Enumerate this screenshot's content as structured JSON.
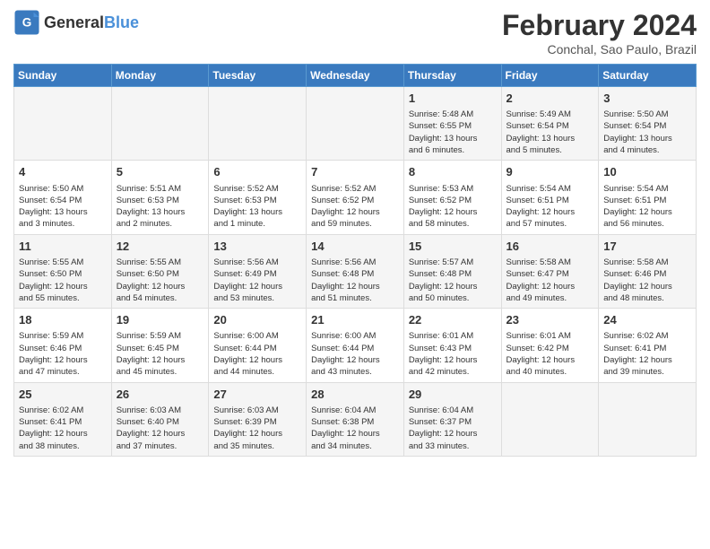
{
  "header": {
    "logo_general": "General",
    "logo_blue": "Blue",
    "title": "February 2024",
    "subtitle": "Conchal, Sao Paulo, Brazil"
  },
  "days_of_week": [
    "Sunday",
    "Monday",
    "Tuesday",
    "Wednesday",
    "Thursday",
    "Friday",
    "Saturday"
  ],
  "weeks": [
    [
      {
        "day": "",
        "content": ""
      },
      {
        "day": "",
        "content": ""
      },
      {
        "day": "",
        "content": ""
      },
      {
        "day": "",
        "content": ""
      },
      {
        "day": "1",
        "content": "Sunrise: 5:48 AM\nSunset: 6:55 PM\nDaylight: 13 hours\nand 6 minutes."
      },
      {
        "day": "2",
        "content": "Sunrise: 5:49 AM\nSunset: 6:54 PM\nDaylight: 13 hours\nand 5 minutes."
      },
      {
        "day": "3",
        "content": "Sunrise: 5:50 AM\nSunset: 6:54 PM\nDaylight: 13 hours\nand 4 minutes."
      }
    ],
    [
      {
        "day": "4",
        "content": "Sunrise: 5:50 AM\nSunset: 6:54 PM\nDaylight: 13 hours\nand 3 minutes."
      },
      {
        "day": "5",
        "content": "Sunrise: 5:51 AM\nSunset: 6:53 PM\nDaylight: 13 hours\nand 2 minutes."
      },
      {
        "day": "6",
        "content": "Sunrise: 5:52 AM\nSunset: 6:53 PM\nDaylight: 13 hours\nand 1 minute."
      },
      {
        "day": "7",
        "content": "Sunrise: 5:52 AM\nSunset: 6:52 PM\nDaylight: 12 hours\nand 59 minutes."
      },
      {
        "day": "8",
        "content": "Sunrise: 5:53 AM\nSunset: 6:52 PM\nDaylight: 12 hours\nand 58 minutes."
      },
      {
        "day": "9",
        "content": "Sunrise: 5:54 AM\nSunset: 6:51 PM\nDaylight: 12 hours\nand 57 minutes."
      },
      {
        "day": "10",
        "content": "Sunrise: 5:54 AM\nSunset: 6:51 PM\nDaylight: 12 hours\nand 56 minutes."
      }
    ],
    [
      {
        "day": "11",
        "content": "Sunrise: 5:55 AM\nSunset: 6:50 PM\nDaylight: 12 hours\nand 55 minutes."
      },
      {
        "day": "12",
        "content": "Sunrise: 5:55 AM\nSunset: 6:50 PM\nDaylight: 12 hours\nand 54 minutes."
      },
      {
        "day": "13",
        "content": "Sunrise: 5:56 AM\nSunset: 6:49 PM\nDaylight: 12 hours\nand 53 minutes."
      },
      {
        "day": "14",
        "content": "Sunrise: 5:56 AM\nSunset: 6:48 PM\nDaylight: 12 hours\nand 51 minutes."
      },
      {
        "day": "15",
        "content": "Sunrise: 5:57 AM\nSunset: 6:48 PM\nDaylight: 12 hours\nand 50 minutes."
      },
      {
        "day": "16",
        "content": "Sunrise: 5:58 AM\nSunset: 6:47 PM\nDaylight: 12 hours\nand 49 minutes."
      },
      {
        "day": "17",
        "content": "Sunrise: 5:58 AM\nSunset: 6:46 PM\nDaylight: 12 hours\nand 48 minutes."
      }
    ],
    [
      {
        "day": "18",
        "content": "Sunrise: 5:59 AM\nSunset: 6:46 PM\nDaylight: 12 hours\nand 47 minutes."
      },
      {
        "day": "19",
        "content": "Sunrise: 5:59 AM\nSunset: 6:45 PM\nDaylight: 12 hours\nand 45 minutes."
      },
      {
        "day": "20",
        "content": "Sunrise: 6:00 AM\nSunset: 6:44 PM\nDaylight: 12 hours\nand 44 minutes."
      },
      {
        "day": "21",
        "content": "Sunrise: 6:00 AM\nSunset: 6:44 PM\nDaylight: 12 hours\nand 43 minutes."
      },
      {
        "day": "22",
        "content": "Sunrise: 6:01 AM\nSunset: 6:43 PM\nDaylight: 12 hours\nand 42 minutes."
      },
      {
        "day": "23",
        "content": "Sunrise: 6:01 AM\nSunset: 6:42 PM\nDaylight: 12 hours\nand 40 minutes."
      },
      {
        "day": "24",
        "content": "Sunrise: 6:02 AM\nSunset: 6:41 PM\nDaylight: 12 hours\nand 39 minutes."
      }
    ],
    [
      {
        "day": "25",
        "content": "Sunrise: 6:02 AM\nSunset: 6:41 PM\nDaylight: 12 hours\nand 38 minutes."
      },
      {
        "day": "26",
        "content": "Sunrise: 6:03 AM\nSunset: 6:40 PM\nDaylight: 12 hours\nand 37 minutes."
      },
      {
        "day": "27",
        "content": "Sunrise: 6:03 AM\nSunset: 6:39 PM\nDaylight: 12 hours\nand 35 minutes."
      },
      {
        "day": "28",
        "content": "Sunrise: 6:04 AM\nSunset: 6:38 PM\nDaylight: 12 hours\nand 34 minutes."
      },
      {
        "day": "29",
        "content": "Sunrise: 6:04 AM\nSunset: 6:37 PM\nDaylight: 12 hours\nand 33 minutes."
      },
      {
        "day": "",
        "content": ""
      },
      {
        "day": "",
        "content": ""
      }
    ]
  ]
}
